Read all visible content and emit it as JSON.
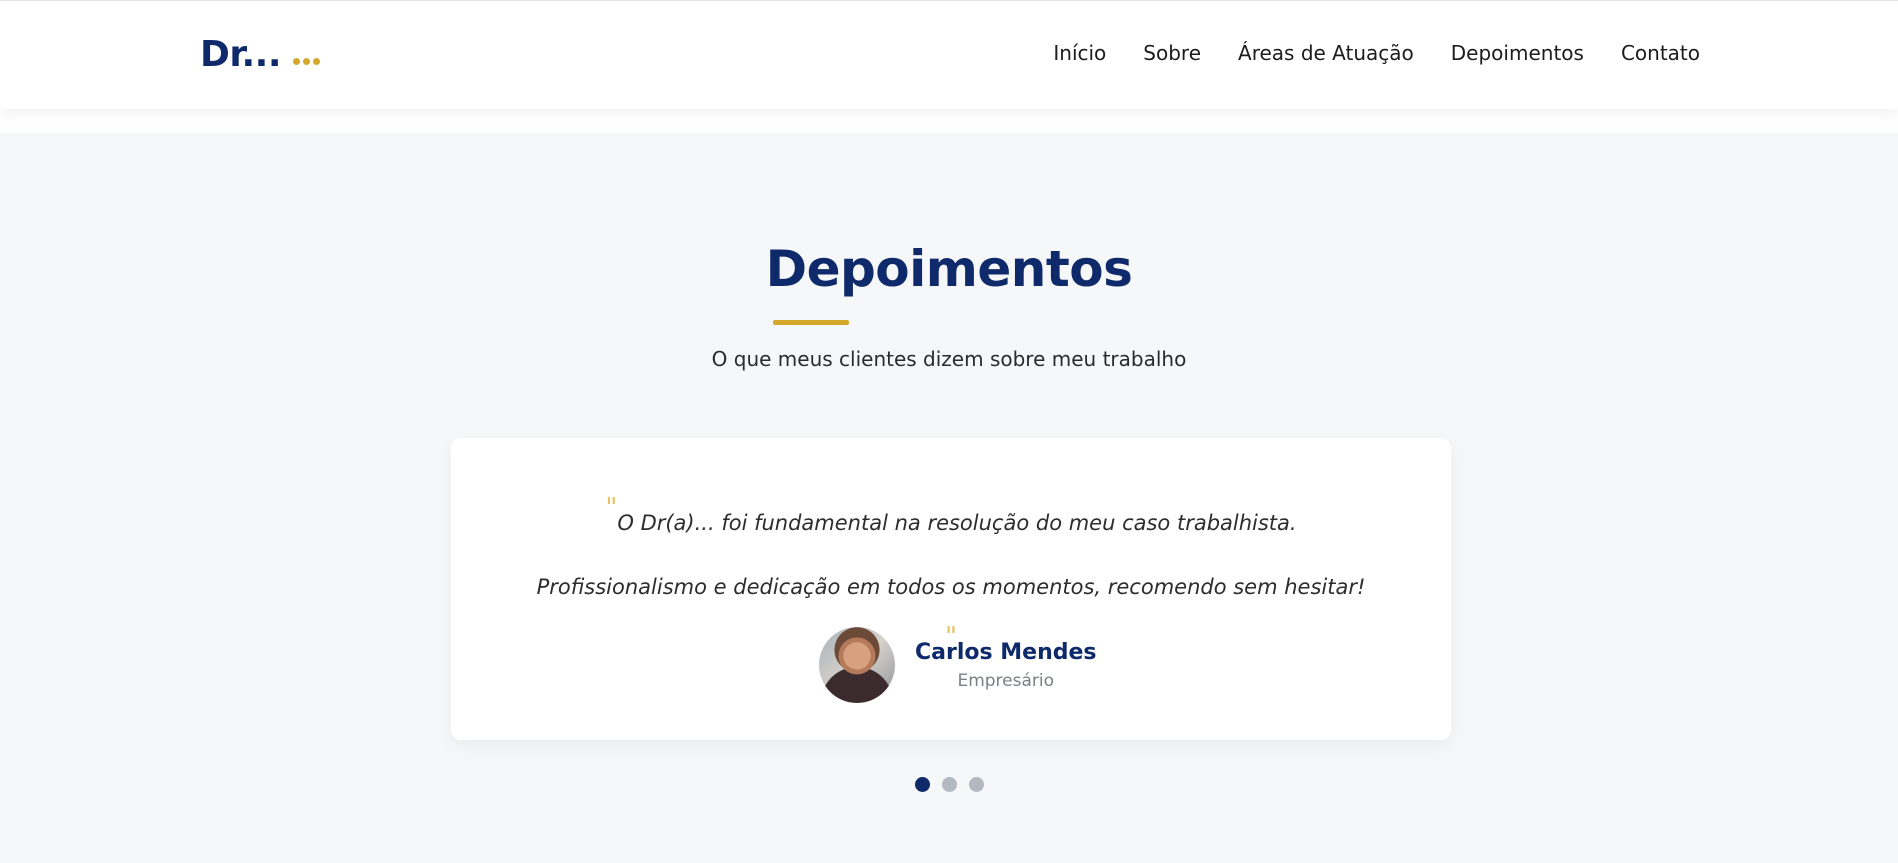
{
  "header": {
    "logo_text": "Dr...",
    "nav": [
      "Início",
      "Sobre",
      "Áreas de Atuação",
      "Depoimentos",
      "Contato"
    ]
  },
  "section": {
    "title": "Depoimentos",
    "subtitle": "O que meus clientes dizem sobre meu trabalho"
  },
  "testimonial": {
    "quote": "O Dr(a)... foi fundamental na resolução do meu caso trabalhista. Profissionalismo e dedicação em todos os momentos, recomendo sem hesitar!",
    "author_name": "Carlos Mendes",
    "author_role": "Empresário",
    "open_mark": "\"",
    "close_mark": "\""
  },
  "carousel": {
    "count": 3,
    "active_index": 0
  },
  "colors": {
    "brand": "#0f2a6b",
    "accent": "#d4a82a",
    "background": "#f6f7f9"
  }
}
